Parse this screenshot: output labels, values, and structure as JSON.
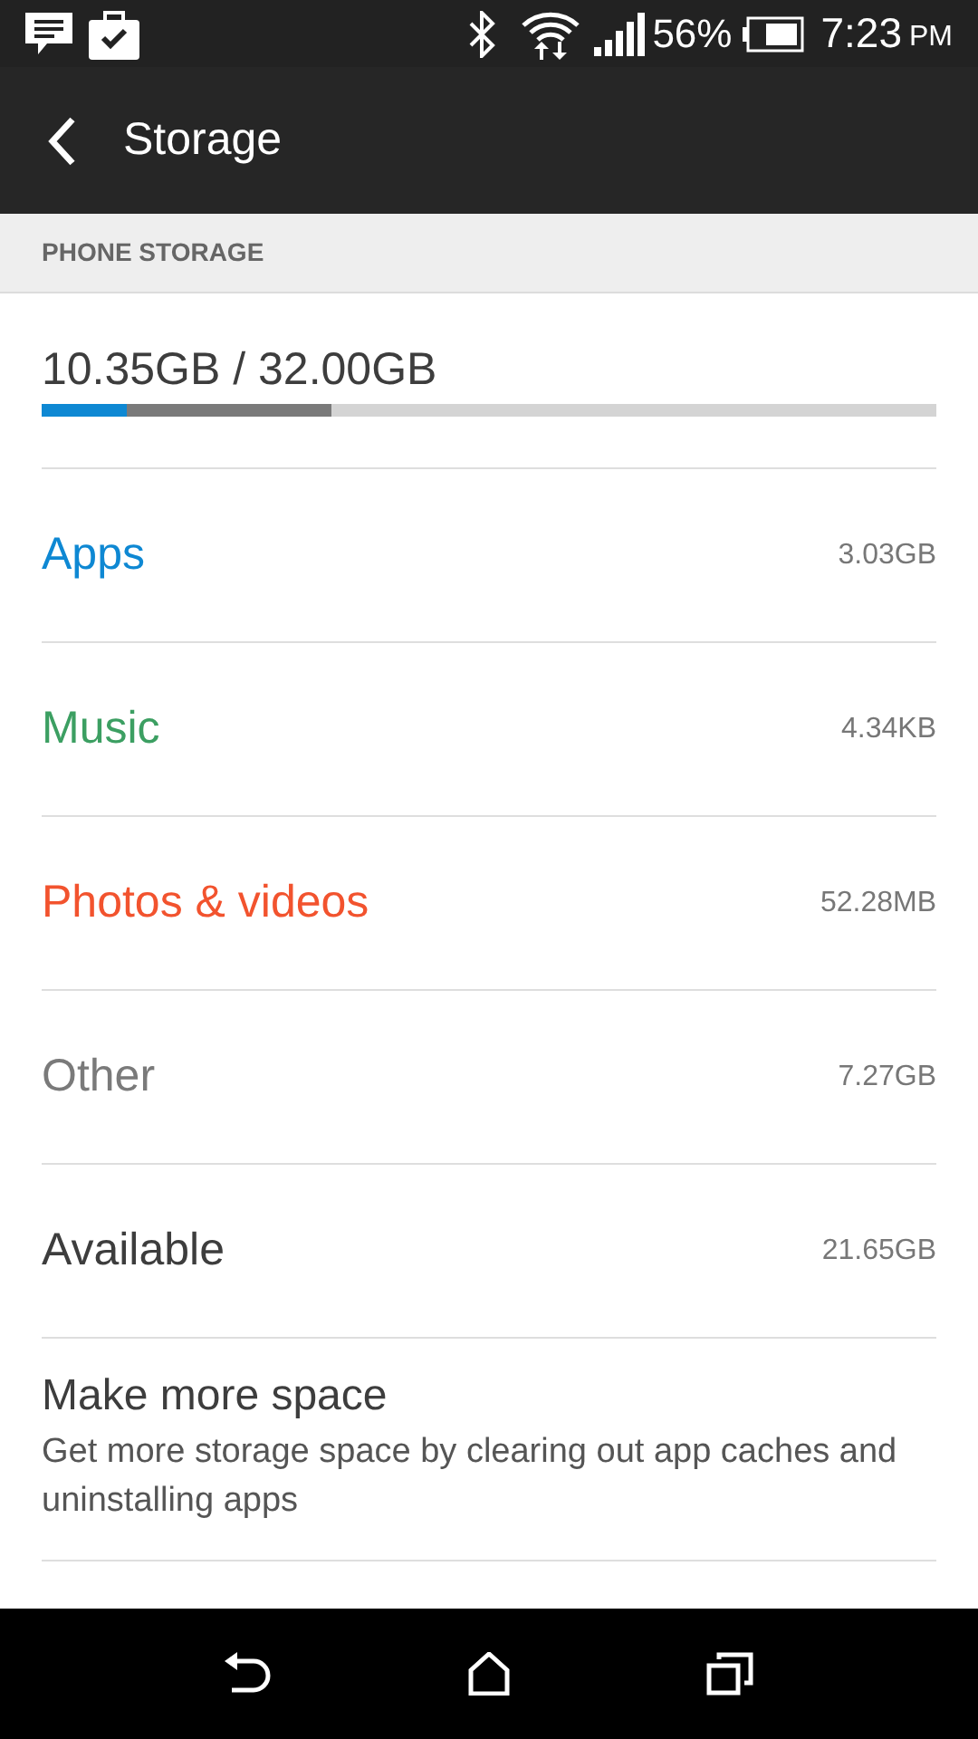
{
  "status_bar": {
    "battery": "56%",
    "time": "7:23",
    "meridiem": "PM"
  },
  "header": {
    "title": "Storage"
  },
  "section": {
    "title": "PHONE STORAGE"
  },
  "summary": {
    "text": "10.35GB / 32.00GB",
    "segments": [
      {
        "level": 0.095,
        "color": "#0e88d3"
      },
      {
        "level": 0.229,
        "color": "#7a7a7a"
      }
    ]
  },
  "categories": [
    {
      "label": "Apps",
      "size": "3.03GB",
      "color": "#0e88d3"
    },
    {
      "label": "Music",
      "size": "4.34KB",
      "color": "#3c9f62"
    },
    {
      "label": "Photos & videos",
      "size": "52.28MB",
      "color": "#f2532e"
    },
    {
      "label": "Other",
      "size": "7.27GB",
      "color": "#7a7a7a"
    },
    {
      "label": "Available",
      "size": "21.65GB",
      "color": "#3d3d3d"
    }
  ],
  "make_space": {
    "title": "Make more space",
    "description": "Get more storage space by clearing out app caches and uninstalling apps"
  }
}
